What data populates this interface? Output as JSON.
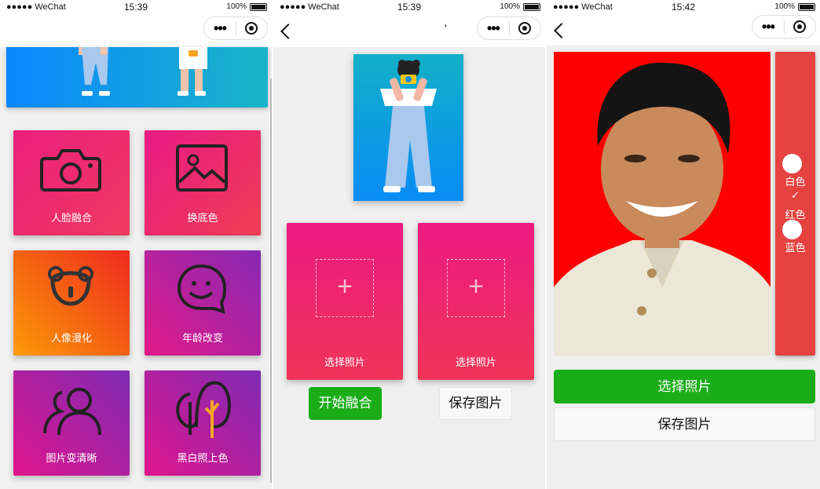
{
  "phones": [
    {
      "status": {
        "carrier": "●●●●● WeChat",
        "time": "15:39",
        "battery": "100%"
      }
    },
    {
      "status": {
        "carrier": "●●●●● WeChat",
        "time": "15:39",
        "battery": "100%"
      }
    },
    {
      "status": {
        "carrier": "●●●●● WeChat",
        "time": "15:42",
        "battery": "100%"
      }
    }
  ],
  "capsule": {
    "menu": "•••"
  },
  "home": {
    "features": [
      {
        "label": "人脸融合",
        "icon": "camera-icon"
      },
      {
        "label": "换底色",
        "icon": "image-icon"
      },
      {
        "label": "人像漫化",
        "icon": "bear-icon"
      },
      {
        "label": "年龄改变",
        "icon": "smile-face-icon"
      },
      {
        "label": "图片变清晰",
        "icon": "users-icon"
      },
      {
        "label": "黑白照上色",
        "icon": "tree-icon"
      }
    ]
  },
  "fusion": {
    "nav_title": "'",
    "pickers": [
      {
        "label": "选择照片",
        "plus": "+"
      },
      {
        "label": "选择照片",
        "plus": "+"
      }
    ],
    "start_button": "开始融合",
    "save_button": "保存图片"
  },
  "background": {
    "colors": [
      {
        "label": "白色",
        "color": "#ffffff",
        "selected": false
      },
      {
        "label": "红色",
        "color": "#ff0000",
        "selected": true
      },
      {
        "label": "蓝色",
        "color": "#ffffff",
        "selected": false
      }
    ],
    "check_mark": "✓",
    "select_button": "选择照片",
    "save_button": "保存图片"
  }
}
